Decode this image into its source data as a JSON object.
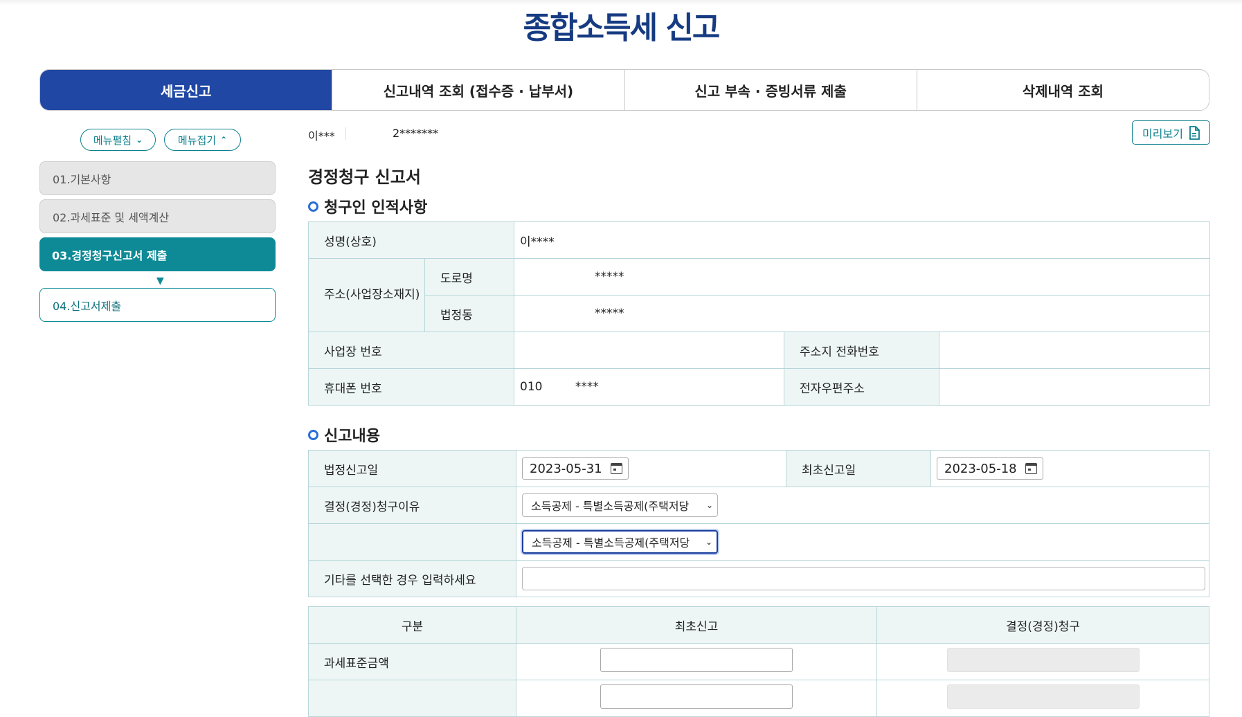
{
  "page_title": "종합소득세 신고",
  "tabs": [
    "세금신고",
    "신고내역 조회 (접수증 · 납부서)",
    "신고 부속 · 증빙서류 제출",
    "삭제내역 조회"
  ],
  "sidebar": {
    "expand_label": "메뉴펼침",
    "collapse_label": "메뉴접기",
    "steps": [
      {
        "label": "01.기본사항",
        "state": "done"
      },
      {
        "label": "02.과세표준 및 세액계산",
        "state": "done"
      },
      {
        "label": "03.경정청구신고서 제출",
        "state": "active"
      },
      {
        "label": "04.신고서제출",
        "state": "todo"
      }
    ]
  },
  "user": {
    "name": "이***",
    "id": "2*******"
  },
  "preview_label": "미리보기",
  "doc_title": "경정청구 신고서",
  "claimant": {
    "section_title": "청구인 인적사항",
    "name_label": "성명(상호)",
    "name_value": "이****",
    "address_label": "주소(사업장소재지)",
    "road_label": "도로명",
    "road_value": "*****",
    "lot_label": "법정동",
    "lot_value": "*****",
    "biz_no_label": "사업장 번호",
    "biz_no_value": "",
    "phone_label": "주소지 전화번호",
    "phone_value": "",
    "mobile_label": "휴대폰 번호",
    "mobile_prefix": "010",
    "mobile_rest": "****",
    "email_label": "전자우편주소",
    "email_value": ""
  },
  "report": {
    "section_title": "신고내용",
    "legal_date_label": "법정신고일",
    "legal_date": "2023-05-31",
    "first_date_label": "최초신고일",
    "first_date": "2023-05-18",
    "reason_label": "결정(경정)청구이유",
    "reason_1": "소득공제 - 특별소득공제(주택저당",
    "reason_2": "소득공제 - 특별소득공제(주택저당",
    "other_label": "기타를 선택한 경우 입력하세요"
  },
  "amounts": {
    "col_category": "구분",
    "col_initial": "최초신고",
    "col_claim": "결정(경정)청구",
    "row_tax_base": "과세표준금액"
  },
  "colors": {
    "primary": "#1f47a3",
    "teal": "#0d8a96",
    "title": "#163b82",
    "label_bg": "#edf6f5"
  }
}
